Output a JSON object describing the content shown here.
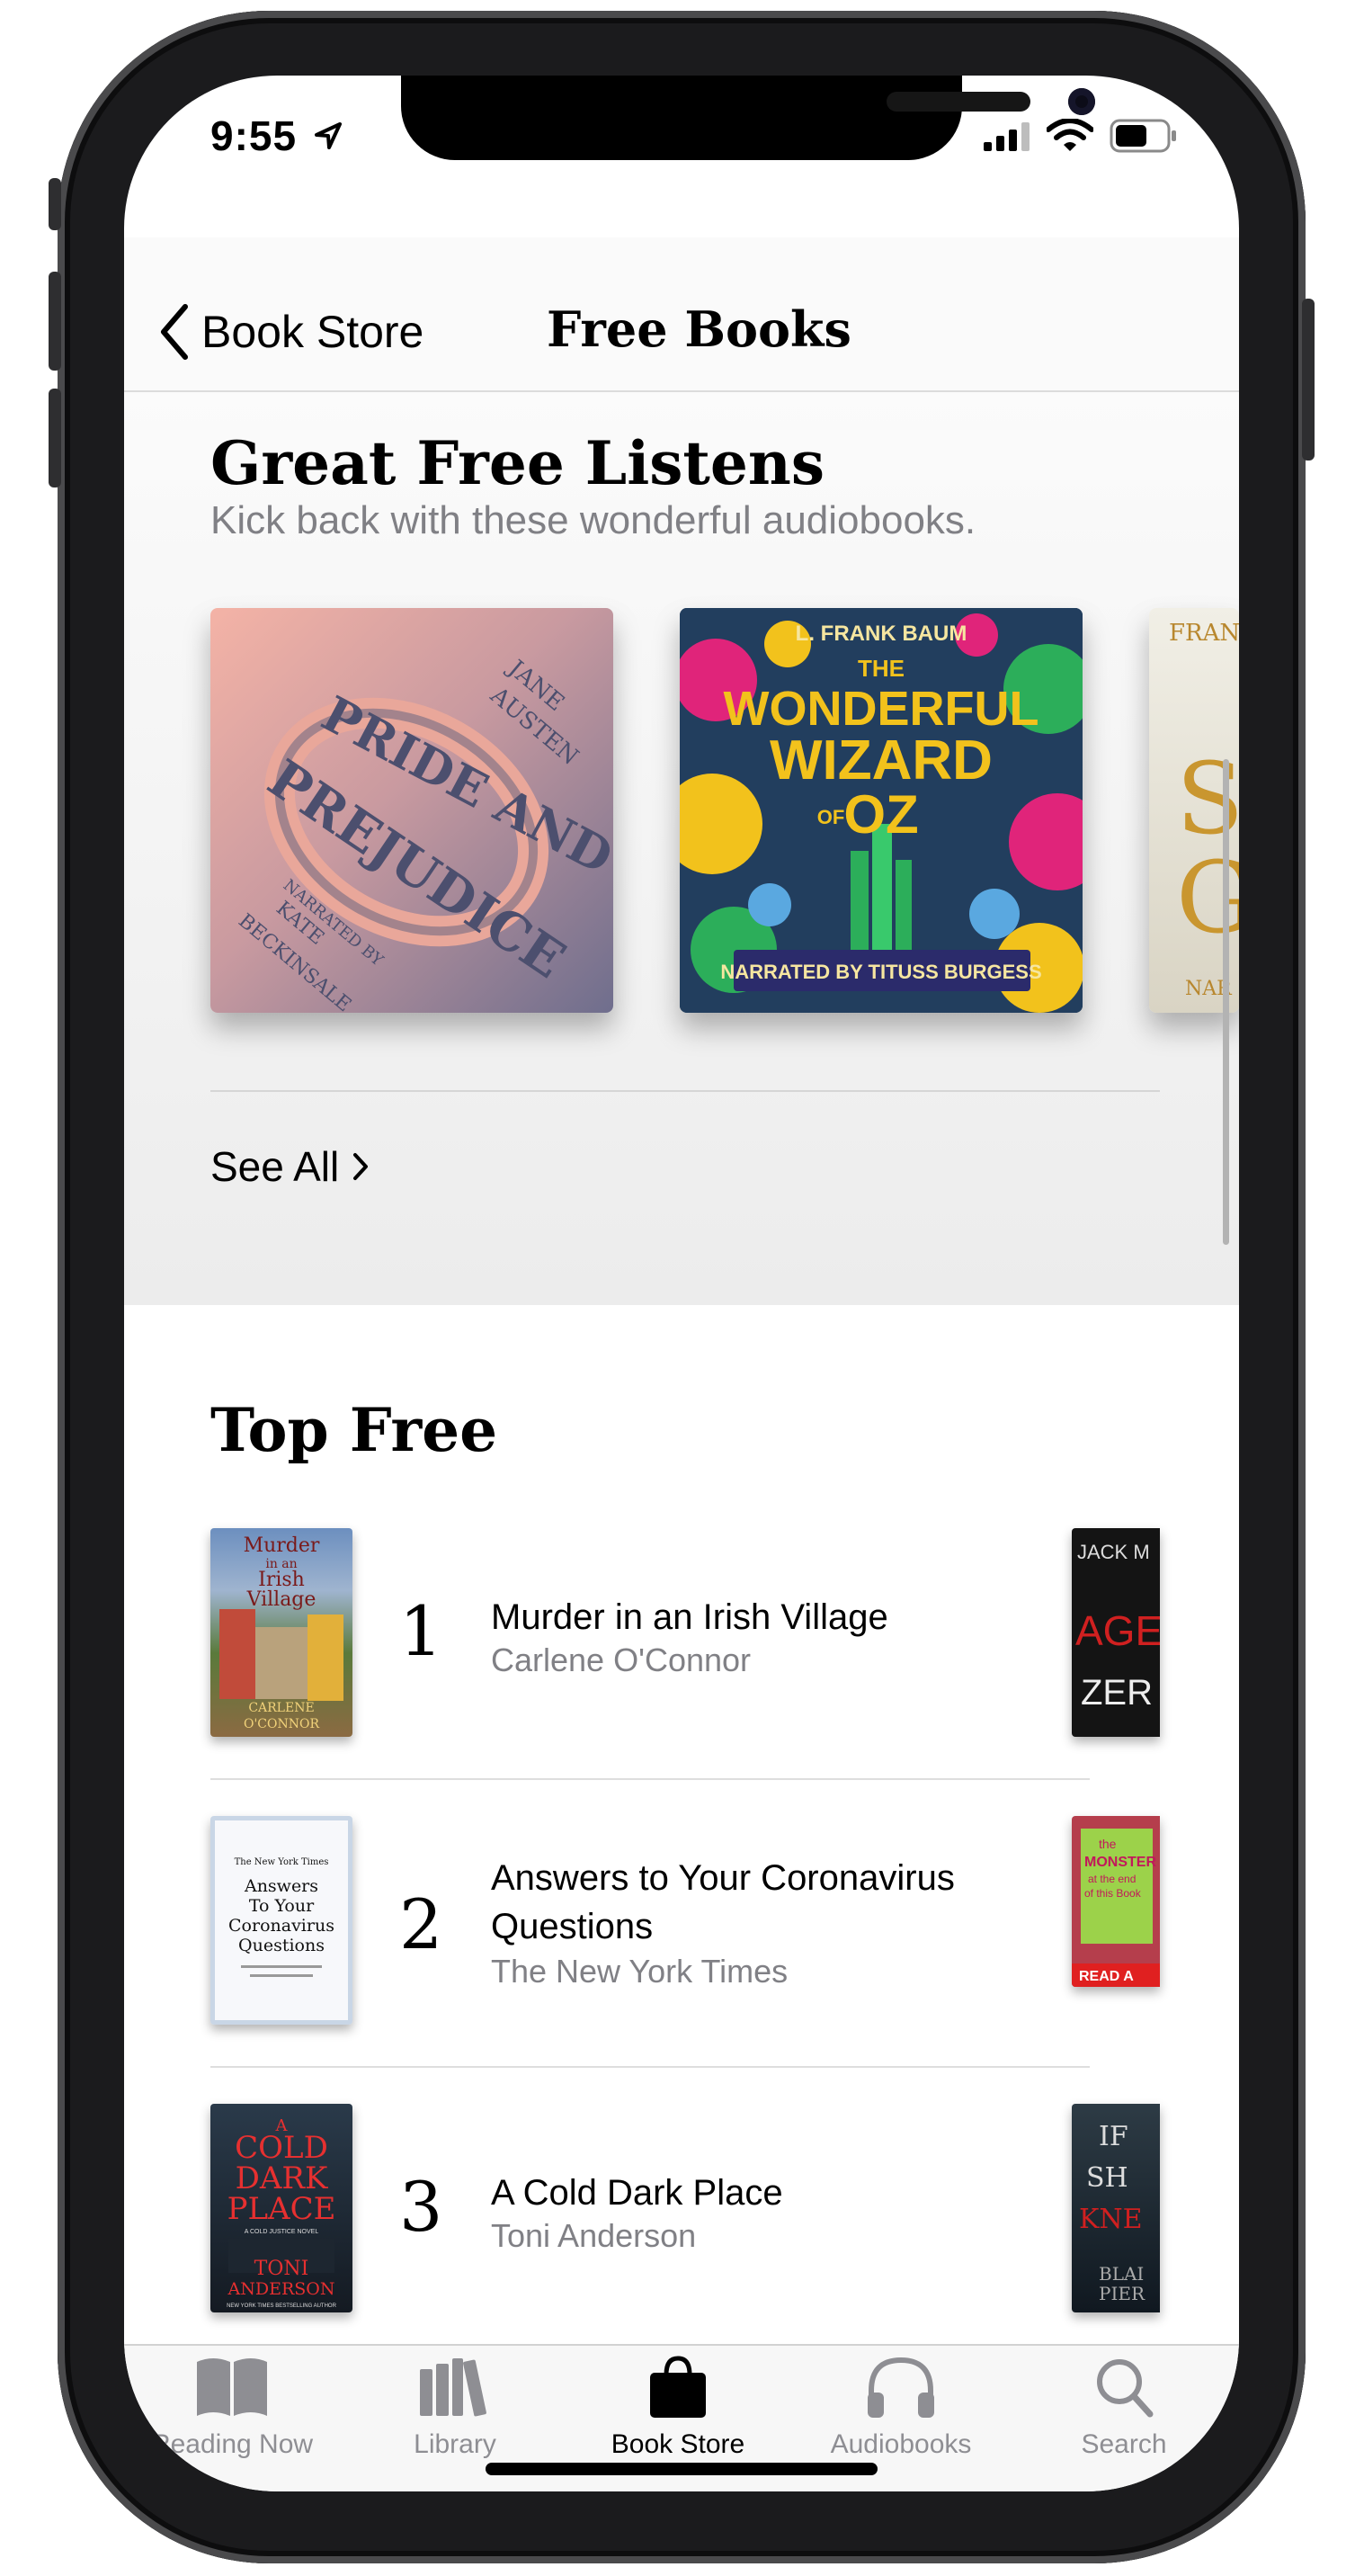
{
  "status": {
    "time": "9:55"
  },
  "nav": {
    "back_label": "Book Store",
    "title": "Free Books"
  },
  "listens": {
    "title": "Great Free Listens",
    "subtitle": "Kick back with these wonderful audiobooks.",
    "see_all": "See All",
    "covers": [
      {
        "lines": [
          "PRIDE AND",
          "PREJUDICE",
          "JANE",
          "AUSTEN",
          "NARRATED BY",
          "KATE",
          "BECKINSALE"
        ]
      },
      {
        "lines": [
          "L. FRANK BAUM",
          "THE",
          "WONDERFUL",
          "WIZARD",
          "OF",
          "OZ",
          "NARRATED BY TITUSS BURGESS"
        ]
      },
      {
        "lines": [
          "FRAN",
          "S",
          "G",
          "NAR"
        ]
      }
    ]
  },
  "top_free": {
    "title": "Top Free",
    "books": [
      {
        "rank": "1",
        "title": "Murder in an Irish Village",
        "author": "Carlene O'Connor",
        "cover_lines": [
          "Murder",
          "in an",
          "Irish",
          "Village",
          "CARLENE",
          "O'CONNOR"
        ]
      },
      {
        "rank": "2",
        "title": "Answers to Your Coronavirus Questions",
        "author": "The New York Times",
        "cover_lines": [
          "The New York Times",
          "Answers",
          "To Your",
          "Coronavirus",
          "Questions"
        ]
      },
      {
        "rank": "3",
        "title": "A Cold Dark Place",
        "author": "Toni Anderson",
        "cover_lines": [
          "A",
          "COLD",
          "DARK",
          "PLACE",
          "A COLD JUSTICE NOVEL",
          "TONI",
          "ANDERSON",
          "NEW YORK TIMES BESTSELLING AUTHOR"
        ]
      }
    ],
    "peek": [
      {
        "lines": [
          "JACK M",
          "AGE",
          "ZER"
        ]
      },
      {
        "lines": [
          "the",
          "MONSTER",
          "at the end",
          "of this Book",
          "READ A"
        ]
      },
      {
        "lines": [
          "IF",
          "SH",
          "KNE",
          "BLAI",
          "PIER"
        ]
      }
    ]
  },
  "tabs": [
    {
      "label": "Reading Now",
      "icon": "book-open-icon"
    },
    {
      "label": "Library",
      "icon": "library-icon"
    },
    {
      "label": "Book Store",
      "icon": "shopping-bag-icon"
    },
    {
      "label": "Audiobooks",
      "icon": "headphones-icon"
    },
    {
      "label": "Search",
      "icon": "magnifier-icon"
    }
  ],
  "colors": {
    "accent": "#000000",
    "secondary_text": "#808085",
    "tab_inactive": "#8e8e93"
  }
}
